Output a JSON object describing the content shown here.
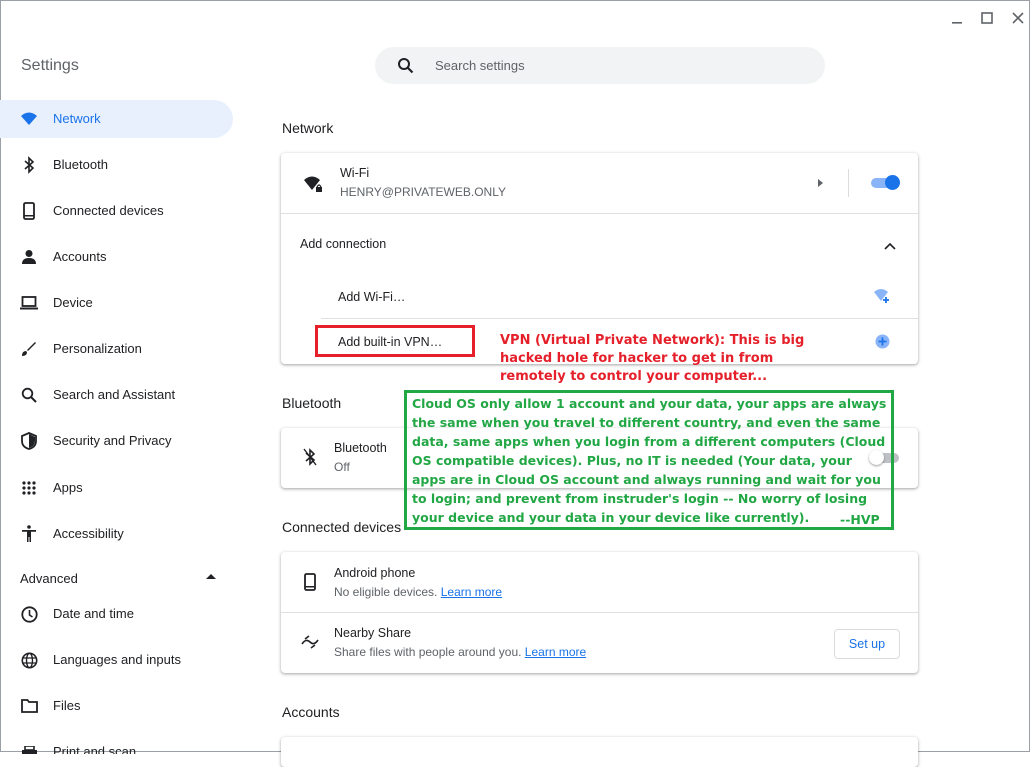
{
  "window": {
    "title": "Settings"
  },
  "search": {
    "placeholder": "Search settings"
  },
  "sidebar": {
    "items": [
      {
        "label": "Network",
        "icon": "wifi-icon"
      },
      {
        "label": "Bluetooth",
        "icon": "bluetooth-icon"
      },
      {
        "label": "Connected devices",
        "icon": "phone-icon"
      },
      {
        "label": "Accounts",
        "icon": "person-icon"
      },
      {
        "label": "Device",
        "icon": "laptop-icon"
      },
      {
        "label": "Personalization",
        "icon": "brush-icon"
      },
      {
        "label": "Search and Assistant",
        "icon": "search-icon"
      },
      {
        "label": "Security and Privacy",
        "icon": "shield-icon"
      },
      {
        "label": "Apps",
        "icon": "apps-grid-icon"
      },
      {
        "label": "Accessibility",
        "icon": "accessibility-icon"
      }
    ],
    "advanced_label": "Advanced",
    "advanced_items": [
      {
        "label": "Date and time",
        "icon": "clock-icon"
      },
      {
        "label": "Languages and inputs",
        "icon": "globe-icon"
      },
      {
        "label": "Files",
        "icon": "folder-icon"
      },
      {
        "label": "Print and scan",
        "icon": "printer-icon"
      }
    ]
  },
  "network": {
    "section_title": "Network",
    "wifi": {
      "title": "Wi-Fi",
      "ssid": "HENRY@PRIVATEWEB.ONLY",
      "enabled": true
    },
    "add_connection": "Add connection",
    "add_wifi": "Add Wi-Fi…",
    "add_vpn": "Add built-in VPN…"
  },
  "bluetooth": {
    "section_title": "Bluetooth",
    "title": "Bluetooth",
    "status": "Off"
  },
  "connected_devices": {
    "section_title": "Connected devices",
    "android": {
      "title": "Android phone",
      "subtitle": "No eligible devices.",
      "link": "Learn more"
    },
    "nearby": {
      "title": "Nearby Share",
      "subtitle": "Share files with people around you.",
      "link": "Learn more",
      "button": "Set up"
    }
  },
  "accounts": {
    "section_title": "Accounts"
  },
  "annotations": {
    "red_note": "VPN (Virtual Private Network): This is big hacked hole for hacker to get in from remotely to control your computer...",
    "green_note": "Cloud OS only allow 1 account and your data, your apps are always the same when you travel to different country, and even the same data, same apps when you login from a different computers (Cloud OS compatible devices). Plus, no IT is needed (Your data, your apps are in Cloud OS account and always running and wait for you to login; and prevent from instruder's login -- No worry of losing your device and your data in your device like currently).",
    "green_signature": "--HVP"
  },
  "colors": {
    "accent": "#1a73e8",
    "annotation_red": "#e5202a",
    "annotation_green": "#22a745"
  }
}
